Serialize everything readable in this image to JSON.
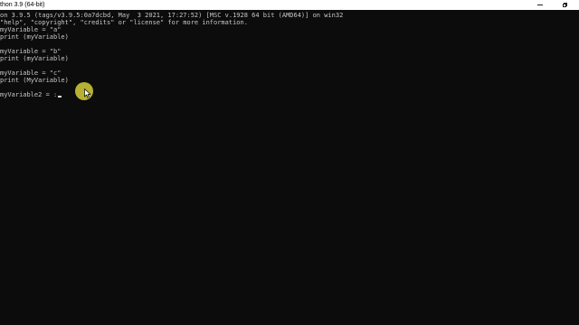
{
  "window": {
    "title": "thon 3.9 (64-bit)"
  },
  "console": {
    "lines": [
      "on 3.9.5 (tags/v3.9.5:0a7dcbd, May  3 2021, 17:27:52) [MSC v.1928 64 bit (AMD64)] on win32",
      "\"help\", \"copyright\", \"credits\" or \"license\" for more information.",
      "myVariable = \"a\"",
      "print (myVariable)",
      "",
      "myVariable = \"b\"",
      "print (myVariable)",
      "",
      "myVariable = \"c\"",
      "print (MyVariable)",
      "",
      "myVariable2 = :"
    ]
  },
  "icons": {
    "minimize": "minimize-icon",
    "maximize": "restore-icon",
    "pointer": "mouse-pointer-icon"
  },
  "colors": {
    "background": "#0c0c0c",
    "text": "#c8c8c8",
    "titlebar": "#ffffff",
    "mouse_highlight": "#cec838"
  }
}
